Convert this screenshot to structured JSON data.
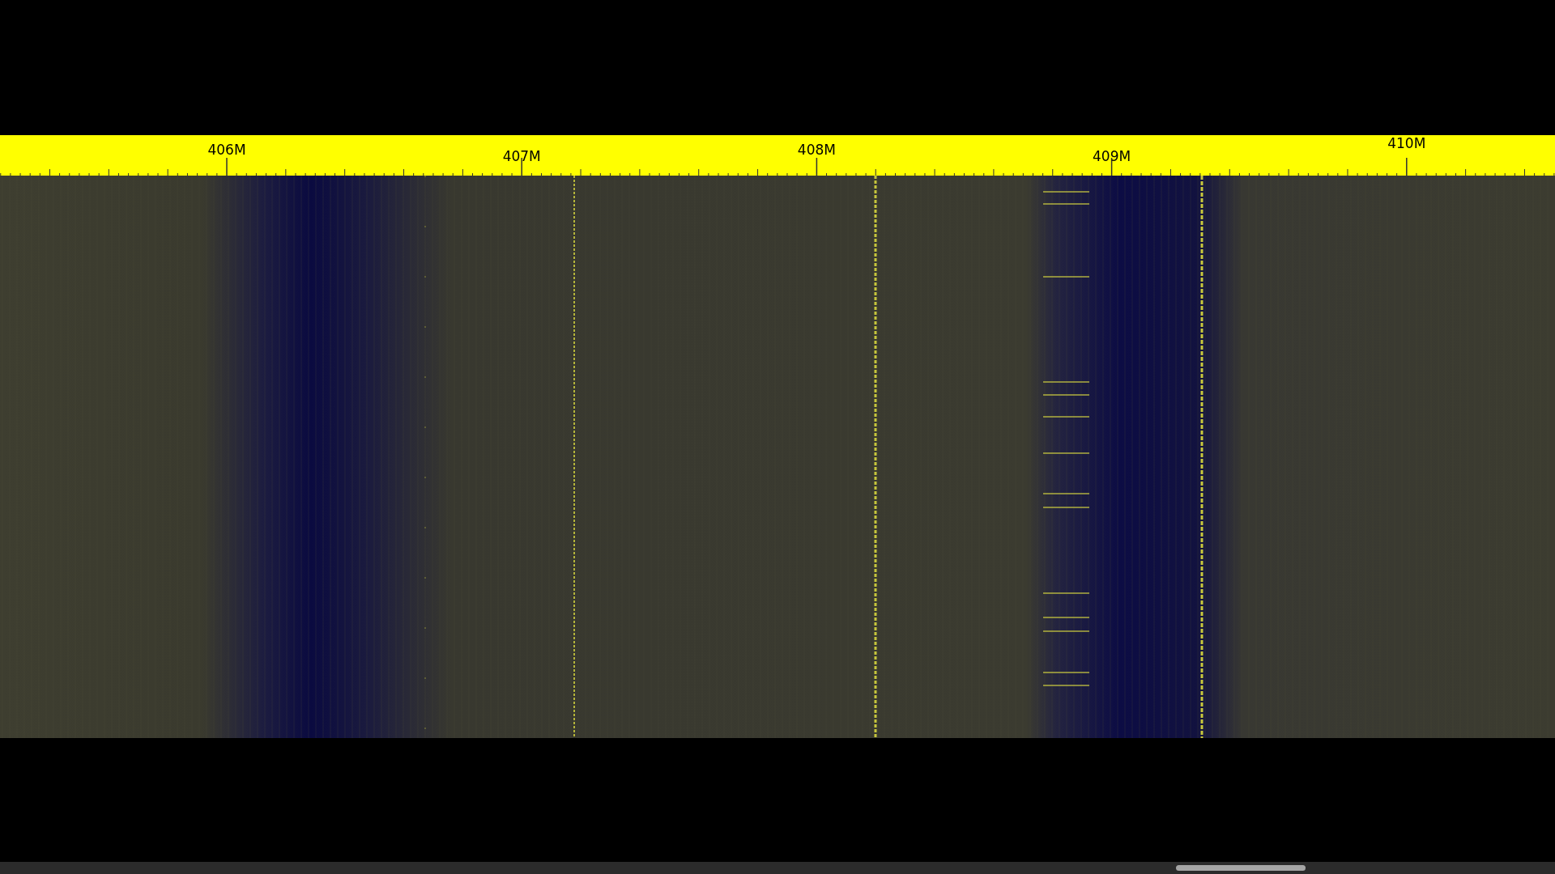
{
  "frequency_axis": {
    "labels": [
      {
        "text": "406M"
      },
      {
        "text": "407M"
      },
      {
        "text": "408M"
      },
      {
        "text": "409M"
      },
      {
        "text": "410M"
      }
    ]
  }
}
